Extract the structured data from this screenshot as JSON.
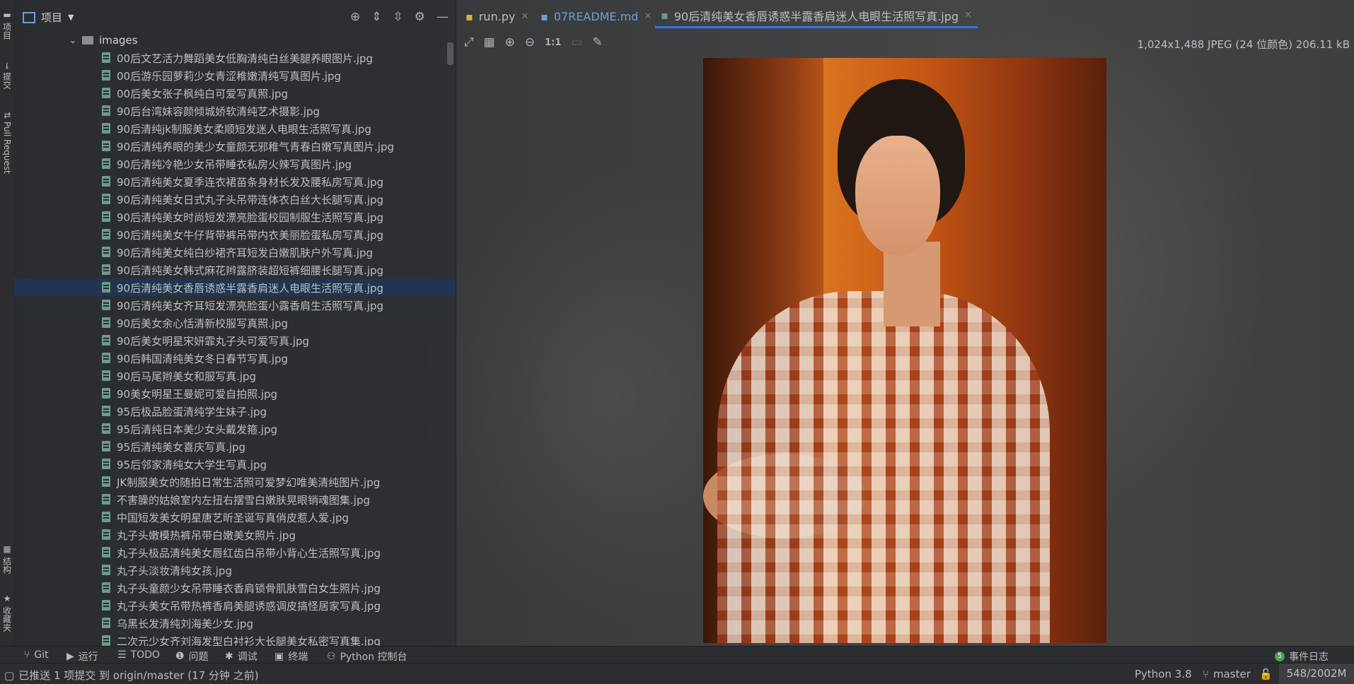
{
  "left_strip": {
    "tabs": [
      "项目",
      "提交",
      "Pull Request",
      "结构",
      "收藏夹"
    ]
  },
  "project_panel": {
    "title": "项目",
    "folder": "images",
    "files": [
      "00后文艺活力舞蹈美女低胸清纯白丝美腿养眼图片.jpg",
      "00后游乐园萝莉少女青涩稚嫩清纯写真图片.jpg",
      "00后美女张子枫纯白可爱写真照.jpg",
      "90后台湾妹容颜倾城娇软清纯艺术摄影.jpg",
      "90后清纯jk制服美女柔顺短发迷人电眼生活照写真.jpg",
      "90后清纯养眼的美少女童颜无邪稚气青春白嫩写真图片.jpg",
      "90后清纯冷艳少女吊带睡衣私房火辣写真图片.jpg",
      "90后清纯美女夏季连衣裙苗条身材长发及腰私房写真.jpg",
      "90后清纯美女日式丸子头吊带连体衣白丝大长腿写真.jpg",
      "90后清纯美女时尚短发漂亮脸蛋校园制服生活照写真.jpg",
      "90后清纯美女牛仔背带裤吊带内衣美丽脸蛋私房写真.jpg",
      "90后清纯美女纯白纱裙齐耳短发白嫩肌肤户外写真.jpg",
      "90后清纯美女韩式麻花辫露脐装超短裤细腰长腿写真.jpg",
      "90后清纯美女香唇诱惑半露香肩迷人电眼生活照写真.jpg",
      "90后清纯美女齐耳短发漂亮脸蛋小露香肩生活照写真.jpg",
      "90后美女余心恬清新校服写真照.jpg",
      "90后美女明星宋妍霏丸子头可爱写真.jpg",
      "90后韩国清纯美女冬日春节写真.jpg",
      "90后马尾辫美女和服写真.jpg",
      "90美女明星王曼妮可爱自拍照.jpg",
      "95后极品脸蛋清纯学生妹子.jpg",
      "95后清纯日本美少女头戴发箍.jpg",
      "95后清纯美女喜庆写真.jpg",
      "95后邻家清纯女大学生写真.jpg",
      "JK制服美女的随拍日常生活照可爱梦幻唯美清纯图片.jpg",
      "不害臊的姑娘室内左扭右摆雪白嫩肤晃眼销魂图集.jpg",
      "中国短发美女明星唐艺昕圣诞写真俏皮惹人爱.jpg",
      "丸子头嫩模热裤吊带白嫩美女照片.jpg",
      "丸子头极品清纯美女唇红齿白吊带小背心生活照写真.jpg",
      "丸子头淡妆清纯女孩.jpg",
      "丸子头童颜少女吊带睡衣香肩锁骨肌肤雪白女生照片.jpg",
      "丸子头美女吊带热裤香肩美腿诱惑调皮搞怪居家写真.jpg",
      "乌黑长发清纯刘海美少女.jpg",
      "二次元少女齐刘海发型白衬衫大长腿美女私密写真集.jpg"
    ],
    "selected_index": 13
  },
  "tabs": [
    {
      "label": "run.py"
    },
    {
      "label": "07README.md"
    },
    {
      "label": "90后清纯美女香唇诱惑半露香肩迷人电眼生活照写真.jpg"
    }
  ],
  "image_toolbar": {
    "zoom_label": "1:1",
    "info": "1,024x1,488 JPEG (24 位颜色) 206.11 kB"
  },
  "bottom_tools": {
    "git": "Git",
    "run": "运行",
    "todo": "TODO",
    "problems": "问题",
    "debug": "调试",
    "terminal": "终端",
    "python_console": "Python 控制台",
    "event_log": "事件日志",
    "event_count": "5"
  },
  "status_bar": {
    "message": "已推送 1 项提交 到 origin/master (17 分钟 之前)",
    "interpreter": "Python 3.8",
    "branch": "master",
    "memory": "548/2002M"
  }
}
